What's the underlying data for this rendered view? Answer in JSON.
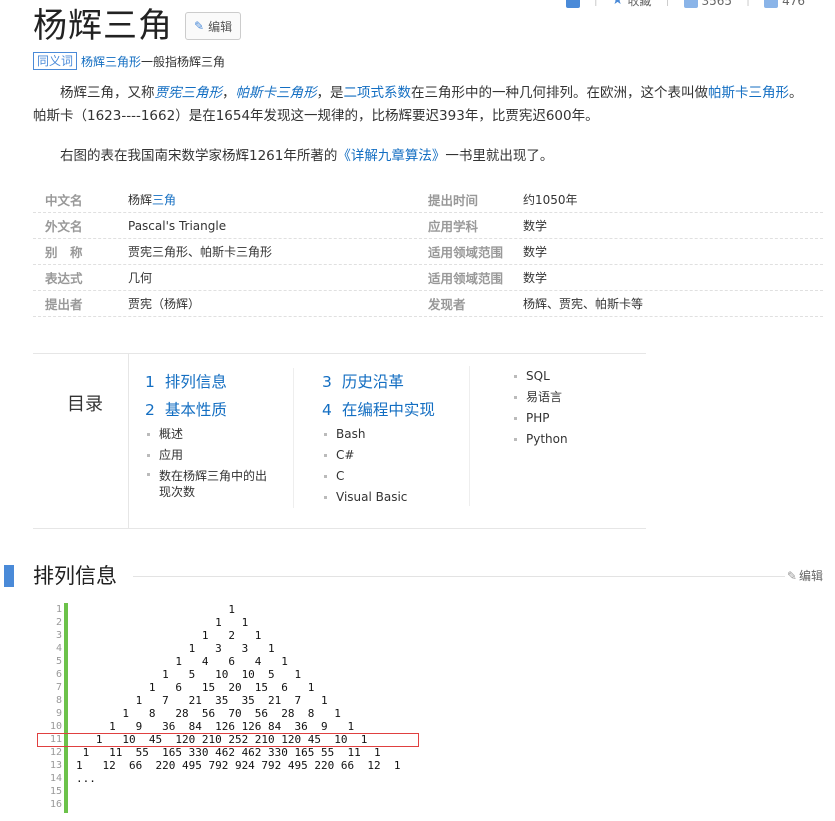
{
  "top_tools": {
    "collect": "收藏",
    "count_a": "3565",
    "count_b": "476"
  },
  "title": "杨辉三角",
  "edit_label": "编辑",
  "synonym": {
    "tag": "同义词",
    "link": "杨辉三角形",
    "rest": "一般指杨辉三角"
  },
  "p1": {
    "a": "杨辉三角，又称",
    "i1": "贾宪三角形",
    "b": "，",
    "i2": "帕斯卡三角形",
    "c": "，是",
    "l1": "二项式系数",
    "d": "在三角形中的一种几何排列。在欧洲，这个表叫做",
    "l2": "帕斯卡三角形",
    "e": "。帕斯卡（1623----1662）是在1654年发现这一规律的，比杨辉要迟393年，比贾宪迟600年。"
  },
  "p2": {
    "a": "右图的表在我国南宋数学家杨辉1261年所著的",
    "link": "《详解九章算法》",
    "b": "一书里就出现了。"
  },
  "info": [
    {
      "k": "中文名",
      "v": "杨辉",
      "v_hl": "三角",
      "k2": "提出时间",
      "v2": "约1050年"
    },
    {
      "k": "外文名",
      "v": "Pascal's Triangle",
      "v_hl": "",
      "k2": "应用学科",
      "v2": "数学"
    },
    {
      "k": "别　称",
      "v": "贾宪三角形、帕斯卡三角形",
      "v_hl": "",
      "k2": "适用领域范围",
      "v2": "数学"
    },
    {
      "k": "表达式",
      "v": "几何",
      "v_hl": "",
      "k2": "适用领域范围",
      "v2": "数学"
    },
    {
      "k": "提出者",
      "v": "贾宪（杨辉）",
      "v_hl": "",
      "k2": "发现者",
      "v2": "杨辉、贾宪、帕斯卡等"
    }
  ],
  "catalog": {
    "title": "目录",
    "col1": [
      {
        "n": "1",
        "label": "排列信息"
      },
      {
        "n": "2",
        "label": "基本性质"
      }
    ],
    "col1_sub": [
      "概述",
      "应用",
      "数在杨辉三角中的出现次数"
    ],
    "col2": [
      {
        "n": "3",
        "label": "历史沿革"
      },
      {
        "n": "4",
        "label": "在编程中实现"
      }
    ],
    "col2_sub": [
      "Bash",
      "C#",
      "C",
      "Visual Basic"
    ],
    "col3_sub": [
      "SQL",
      "易语言",
      "PHP",
      "Python"
    ]
  },
  "section": {
    "title": "排列信息",
    "edit": "编辑"
  },
  "code": {
    "line_numbers": [
      "1",
      "2",
      "3",
      "4",
      "5",
      "6",
      "7",
      "8",
      "9",
      "10",
      "11",
      "12",
      "13",
      "14",
      "15",
      "16"
    ],
    "lines": [
      "                       1",
      "                     1   1",
      "                   1   2   1",
      "                 1   3   3   1",
      "               1   4   6   4   1",
      "             1   5   10  10  5   1",
      "           1   6   15  20  15  6   1",
      "         1   7   21  35  35  21  7   1",
      "       1   8   28  56  70  56  28  8   1",
      "     1   9   36  84  126 126 84  36  9   1",
      "   1   10  45  120 210 252 210 120 45  10  1",
      " 1   11  55  165 330 462 462 330 165 55  11  1",
      "1   12  66  220 495 792 924 792 495 220 66  12  1",
      "...",
      "",
      ""
    ]
  }
}
